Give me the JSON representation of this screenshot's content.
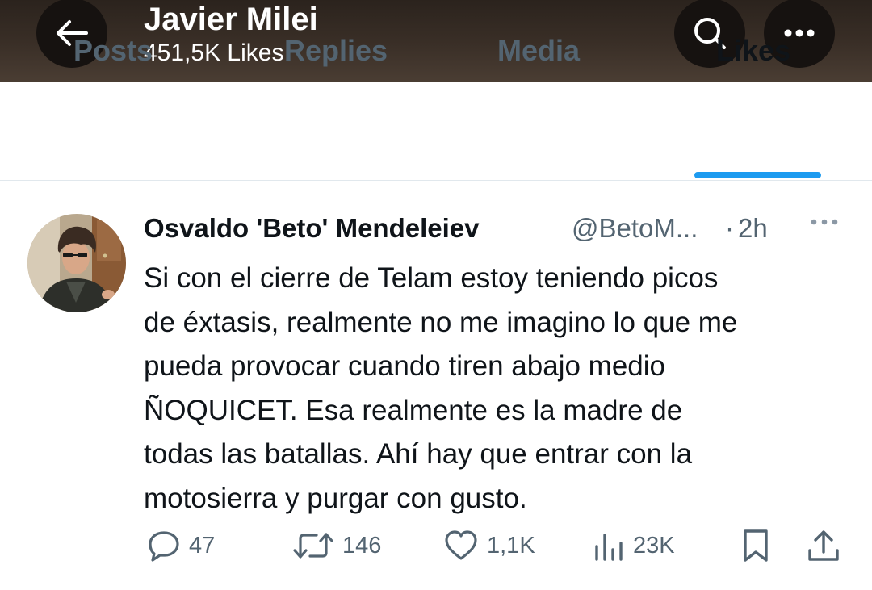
{
  "header": {
    "title": "Javier Milei",
    "subtitle": "451,5K Likes",
    "back_icon": "arrow-left-icon",
    "search_icon": "search-icon",
    "more_icon": "more-horizontal-icon"
  },
  "tabs": [
    {
      "label": "Posts",
      "active": false
    },
    {
      "label": "Replies",
      "active": false
    },
    {
      "label": "Media",
      "active": false
    },
    {
      "label": "Likes",
      "active": true
    }
  ],
  "tweet": {
    "author_name": "Osvaldo 'Beto' Mendeleiev",
    "handle": "@BetoM...",
    "separator": "·",
    "time": "2h",
    "body_lines": [
      "Si con el cierre de Telam estoy teniendo picos",
      "de éxtasis, realmente no me imagino lo que me",
      "pueda provocar cuando tiren abajo medio",
      "ÑOQUICET. Esa realmente es la madre de",
      "todas las batallas. Ahí hay que entrar con la",
      "motosierra y purgar con gusto."
    ],
    "stats": {
      "replies": "47",
      "retweets": "146",
      "likes": "1,1K",
      "views": "23K"
    }
  },
  "colors": {
    "accent": "#1d9bf0",
    "text_primary": "#0f1419",
    "text_secondary": "#536471",
    "header_bg": "#3a2f27"
  }
}
